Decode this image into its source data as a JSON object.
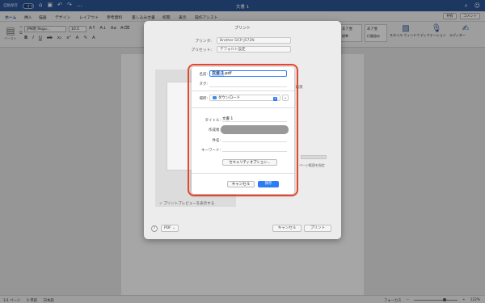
{
  "titlebar": {
    "autosave_label": "自動保存",
    "autosave_state": "オフ",
    "doc_title": "文書 1"
  },
  "tabs": [
    {
      "label": "ホーム",
      "active": true
    },
    {
      "label": "挿入"
    },
    {
      "label": "描画"
    },
    {
      "label": "デザイン"
    },
    {
      "label": "レイアウト"
    },
    {
      "label": "参考資料"
    },
    {
      "label": "差し込み文書"
    },
    {
      "label": "校閲"
    },
    {
      "label": "表示"
    },
    {
      "label": "操作アシスト"
    }
  ],
  "tabs_right": {
    "share": "共有",
    "comments": "コメント"
  },
  "ribbon": {
    "paste": "ペースト",
    "font_name": "JPN明 Regu...",
    "font_size": "10.5",
    "style_cards": [
      {
        "sample": "あア亜",
        "name": "標準"
      },
      {
        "sample": "あア亜",
        "name": "行間詰め"
      }
    ],
    "style_pane": "スタイル ウィンドウ",
    "dictation": "ディクテーション",
    "editor": "エディター"
  },
  "print_dialog": {
    "title": "プリント",
    "printer_label": "プリンタ:",
    "printer_value": "Brother DCP-J572N",
    "preset_label": "プリセット:",
    "preset_value": "デフォルト設定",
    "side_option": "白黒",
    "side_note": "ページ範囲を指定",
    "checkbox": "プリントプレビューを表示する",
    "help": "?",
    "pdf_button": "PDF",
    "cancel_button": "キャンセル",
    "print_button": "プリント"
  },
  "save_dialog": {
    "name_label": "名前:",
    "name_selected": "文書 1",
    "name_ext": ".pdf",
    "tags_label": "タグ:",
    "location_label": "場所:",
    "location_value": "ダウンロード",
    "title_label": "タイトル:",
    "title_value": "文書 1",
    "author_label": "作成者:",
    "subject_label": "件名:",
    "keywords_label": "キーワード:",
    "security_button": "セキュリティオプション...",
    "cancel_button": "キャンセル",
    "save_button": "保存"
  },
  "statusbar": {
    "page": "1/1 ページ",
    "words": "0 単語",
    "language": "日本語",
    "focus": "フォーカス",
    "zoom": "122%"
  }
}
